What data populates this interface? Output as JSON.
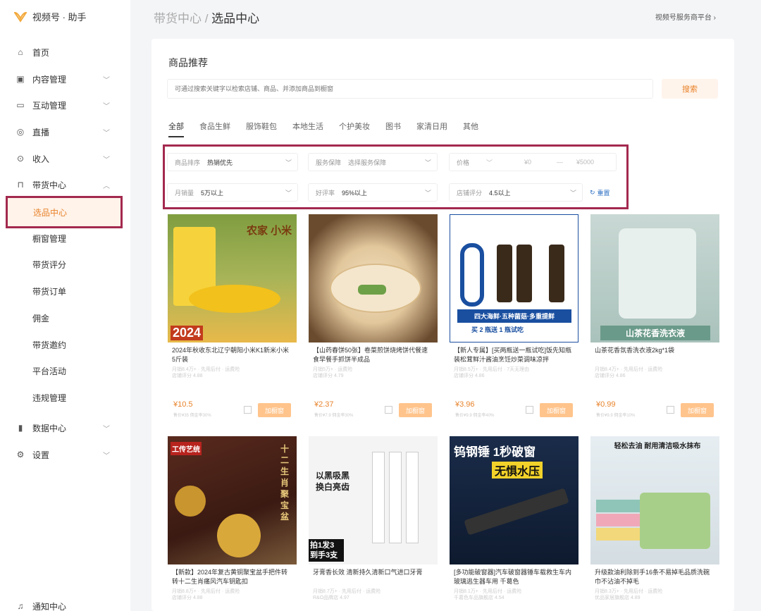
{
  "app": {
    "name": "视频号 · 助手"
  },
  "breadcrumb": {
    "parent": "带货中心",
    "sep": " / ",
    "current": "选品中心"
  },
  "top_link": "视频号服务商平台 ›",
  "sidebar": {
    "items": [
      {
        "label": "首页",
        "icon": "home-icon"
      },
      {
        "label": "内容管理",
        "icon": "content-icon"
      },
      {
        "label": "互动管理",
        "icon": "chat-icon"
      },
      {
        "label": "直播",
        "icon": "live-icon"
      },
      {
        "label": "收入",
        "icon": "income-icon"
      },
      {
        "label": "带货中心",
        "icon": "bag-icon"
      }
    ],
    "subitems": [
      "选品中心",
      "橱窗管理",
      "带货评分",
      "带货订单",
      "佣金",
      "带货邀约",
      "平台活动",
      "违规管理"
    ],
    "bottom": [
      {
        "label": "数据中心",
        "icon": "chart-icon"
      },
      {
        "label": "设置",
        "icon": "gear-icon"
      },
      {
        "label": "通知中心",
        "icon": "bell-icon"
      }
    ]
  },
  "main": {
    "section_title": "商品推荐",
    "search": {
      "placeholder": "可通过搜索关键字以检索店铺、商品、并添加商品到橱窗",
      "button": "搜索"
    },
    "tabs": [
      "全部",
      "食品生鲜",
      "服饰鞋包",
      "本地生活",
      "个护美妆",
      "图书",
      "家清日用",
      "其他"
    ],
    "filters": {
      "sort": {
        "key": "商品排序",
        "value": "热销优先"
      },
      "service": {
        "key": "服务保障",
        "value": "选择服务保障"
      },
      "price": {
        "key": "价格",
        "min": "¥0",
        "dash": "—",
        "max": "¥5000"
      },
      "sales": {
        "key": "月销量",
        "value": "5万以上"
      },
      "rating": {
        "key": "好评率",
        "value": "95%以上"
      },
      "store": {
        "key": "店铺评分",
        "value": "4.5以上"
      },
      "reset": "重置"
    },
    "products": [
      {
        "title": "2024年秋收东北辽宁朝阳小米K1新米小米5斤装",
        "meta": "月销8.4万+ · 先用后付 · 运费险",
        "store": "店铺评分 4.88",
        "price": "¥10.5",
        "sub": "售价¥35 佣金率30%",
        "add": "加橱窗",
        "img_text": "农家 小米",
        "img_badge": "2024"
      },
      {
        "title": "【山药春饼50张】卷菜煎饼烧烤饼代餐速食早餐手抓饼半成品",
        "meta": "月销5万+ · 运费险",
        "store": "店铺评分 4.79",
        "price": "¥2.37",
        "sub": "售价¥7.9 佣金率30%",
        "add": "加橱窗",
        "img_text": "",
        "img_badge": ""
      },
      {
        "title": "【新人专属】[买两瓶送一瓶试吃]饭先知瓶装松茸鲜汁酱油烹饪炒菜调味凉拌",
        "meta": "月销8.5万+ · 先用后付 · 7天无理由",
        "store": "店铺评分 4.86",
        "price": "¥3.96",
        "sub": "售价¥9.9 佣金率40%",
        "add": "加橱窗",
        "img_text": "四大海鲜·五种菌菇·多重提鲜",
        "img_badge": "买 2 瓶送 1 瓶试吃"
      },
      {
        "title": "山茶花香氛香洗衣液2kg*1袋",
        "meta": "月销8.4万+ · 先用后付 · 运费险",
        "store": "店铺评分 4.86",
        "price": "¥0.99",
        "sub": "售价¥9.9 佣金率10%",
        "add": "加橱窗",
        "img_text": "山茶花香洗衣液",
        "img_badge": ""
      },
      {
        "title": "【新款】2024年复古黄铜聚宝盆手把件转转十二生肖痛风汽车钥匙扣",
        "meta": "月销8.8万+ · 先用后付 · 运费险",
        "store": "店铺评分 4.88",
        "price": "",
        "sub": "",
        "add": "",
        "img_text": "十二生肖聚宝盆",
        "img_badge": "工传艺统"
      },
      {
        "title": "牙膏香长效 清新持久清新口气进口牙膏",
        "meta": "月销8.7万+ · 先用后付 · 运费险",
        "store": "R&O品牌店 4.97",
        "price": "",
        "sub": "",
        "add": "",
        "img_text": "以黑吸黑 换白亮齿",
        "img_badge": "拍1发3 到手3支"
      },
      {
        "title": "[多功能破窗器]汽车破窗器锤车载救生车内玻璃逃生器车用 千葛色",
        "meta": "月销8.1万+ · 先用后付 · 运费险",
        "store": "千葛色车品旗舰店 4.54",
        "price": "",
        "sub": "",
        "add": "",
        "img_text": "钨钢锤 1秒破窗",
        "img_badge": "无惧水压"
      },
      {
        "title": "升级款油利除到手16条不易掉毛品质洗碗巾不沾油不掉毛",
        "meta": "月销8.3万+ · 先用后付 · 运费险",
        "store": "优品家居旗舰店 4.89",
        "price": "",
        "sub": "",
        "add": "",
        "img_text": "轻松去油 耐用清洁吸水抹布",
        "img_badge": ""
      }
    ]
  }
}
